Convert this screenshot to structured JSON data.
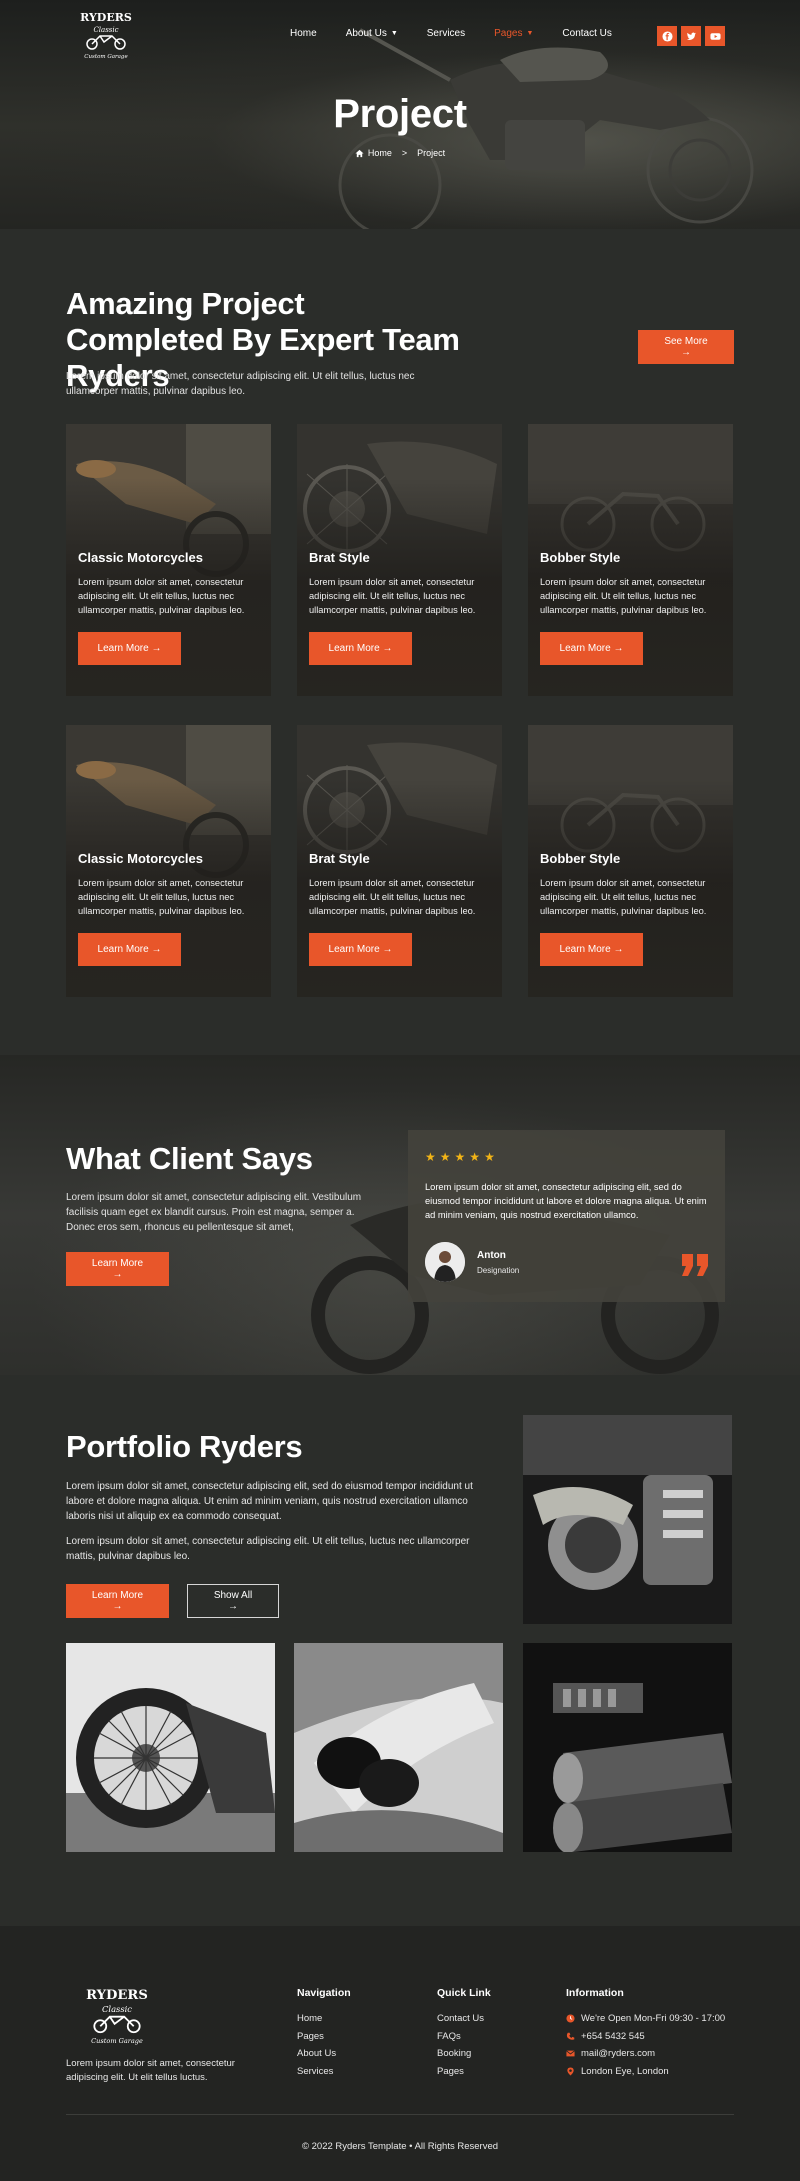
{
  "brand": {
    "logo_text": "RYDERS",
    "logo_sub": "Classic",
    "logo_tagline": "Custom Garage"
  },
  "nav": {
    "items": [
      {
        "label": "Home",
        "caret": false,
        "active": false
      },
      {
        "label": "About Us",
        "caret": true,
        "active": false
      },
      {
        "label": "Services",
        "caret": false,
        "active": false
      },
      {
        "label": "Pages",
        "caret": true,
        "active": true
      },
      {
        "label": "Contact Us",
        "caret": false,
        "active": false
      }
    ],
    "social": [
      "facebook-icon",
      "twitter-icon",
      "youtube-icon"
    ]
  },
  "hero": {
    "title": "Project",
    "breadcrumb_home": "Home",
    "breadcrumb_sep": ">",
    "breadcrumb_current": "Project"
  },
  "projects": {
    "title": "Amazing Project Completed By Expert Team Ryders",
    "description": "Lorem ipsum dolor sit amet, consectetur adipiscing elit. Ut elit tellus, luctus nec ullamcorper mattis, pulvinar dapibus leo.",
    "see_more": "See More →",
    "cards": [
      {
        "title": "Classic Motorcycles",
        "text": "Lorem ipsum dolor sit amet, consectetur adipiscing elit. Ut elit tellus, luctus nec ullamcorper mattis, pulvinar dapibus leo.",
        "button": "Learn More →"
      },
      {
        "title": "Brat Style",
        "text": "Lorem ipsum dolor sit amet, consectetur adipiscing elit. Ut elit tellus, luctus nec ullamcorper mattis, pulvinar dapibus leo.",
        "button": "Learn More →"
      },
      {
        "title": "Bobber Style",
        "text": "Lorem ipsum dolor sit amet, consectetur adipiscing elit. Ut elit tellus, luctus nec ullamcorper mattis, pulvinar dapibus leo.",
        "button": "Learn More →"
      },
      {
        "title": "Classic Motorcycles",
        "text": "Lorem ipsum dolor sit amet, consectetur adipiscing elit. Ut elit tellus, luctus nec ullamcorper mattis, pulvinar dapibus leo.",
        "button": "Learn More →"
      },
      {
        "title": "Brat Style",
        "text": "Lorem ipsum dolor sit amet, consectetur adipiscing elit. Ut elit tellus, luctus nec ullamcorper mattis, pulvinar dapibus leo.",
        "button": "Learn More →"
      },
      {
        "title": "Bobber Style",
        "text": "Lorem ipsum dolor sit amet, consectetur adipiscing elit. Ut elit tellus, luctus nec ullamcorper mattis, pulvinar dapibus leo.",
        "button": "Learn More →"
      }
    ]
  },
  "testimonial": {
    "title": "What Client Says",
    "description": "Lorem ipsum dolor sit amet, consectetur adipiscing elit. Vestibulum facilisis quam eget ex blandit cursus. Proin est magna, semper a. Donec eros sem, rhoncus eu pellentesque sit amet,",
    "button": "Learn More →",
    "rating": 5,
    "quote": "Lorem ipsum dolor sit amet, consectetur adipiscing elit, sed do eiusmod tempor incididunt ut labore et dolore magna aliqua. Ut enim ad minim veniam, quis nostrud exercitation ullamco.",
    "author_name": "Anton",
    "author_role": "Designation"
  },
  "portfolio": {
    "title": "Portfolio Ryders",
    "paragraph_1": "Lorem ipsum dolor sit amet, consectetur adipiscing elit, sed do eiusmod tempor incididunt ut labore et dolore magna aliqua. Ut enim ad minim veniam, quis nostrud exercitation ullamco laboris nisi ut aliquip ex ea commodo consequat.",
    "paragraph_2": "Lorem ipsum dolor sit amet, consectetur adipiscing elit. Ut elit tellus, luctus nec ullamcorper mattis, pulvinar dapibus leo.",
    "button_primary": "Learn More →",
    "button_secondary": "Show All →"
  },
  "footer": {
    "description": "Lorem ipsum dolor sit amet, consectetur adipiscing elit. Ut elit tellus luctus.",
    "navigation_title": "Navigation",
    "navigation": [
      "Home",
      "Pages",
      "About Us",
      "Services"
    ],
    "quicklink_title": "Quick Link",
    "quicklinks": [
      "Contact Us",
      "FAQs",
      "Booking",
      "Pages"
    ],
    "information_title": "Information",
    "information": [
      {
        "icon": "clock-icon",
        "text": "We're Open Mon-Fri 09:30 - 17:00"
      },
      {
        "icon": "phone-icon",
        "text": "+654 5432 545"
      },
      {
        "icon": "mail-icon",
        "text": "mail@ryders.com"
      },
      {
        "icon": "location-icon",
        "text": "London Eye, London"
      }
    ],
    "copyright": "© 2022 Ryders Template • All Rights Reserved"
  },
  "colors": {
    "accent": "#e8562a",
    "background": "#2b2d2a",
    "footer": "#232422",
    "star": "#f2b417"
  }
}
